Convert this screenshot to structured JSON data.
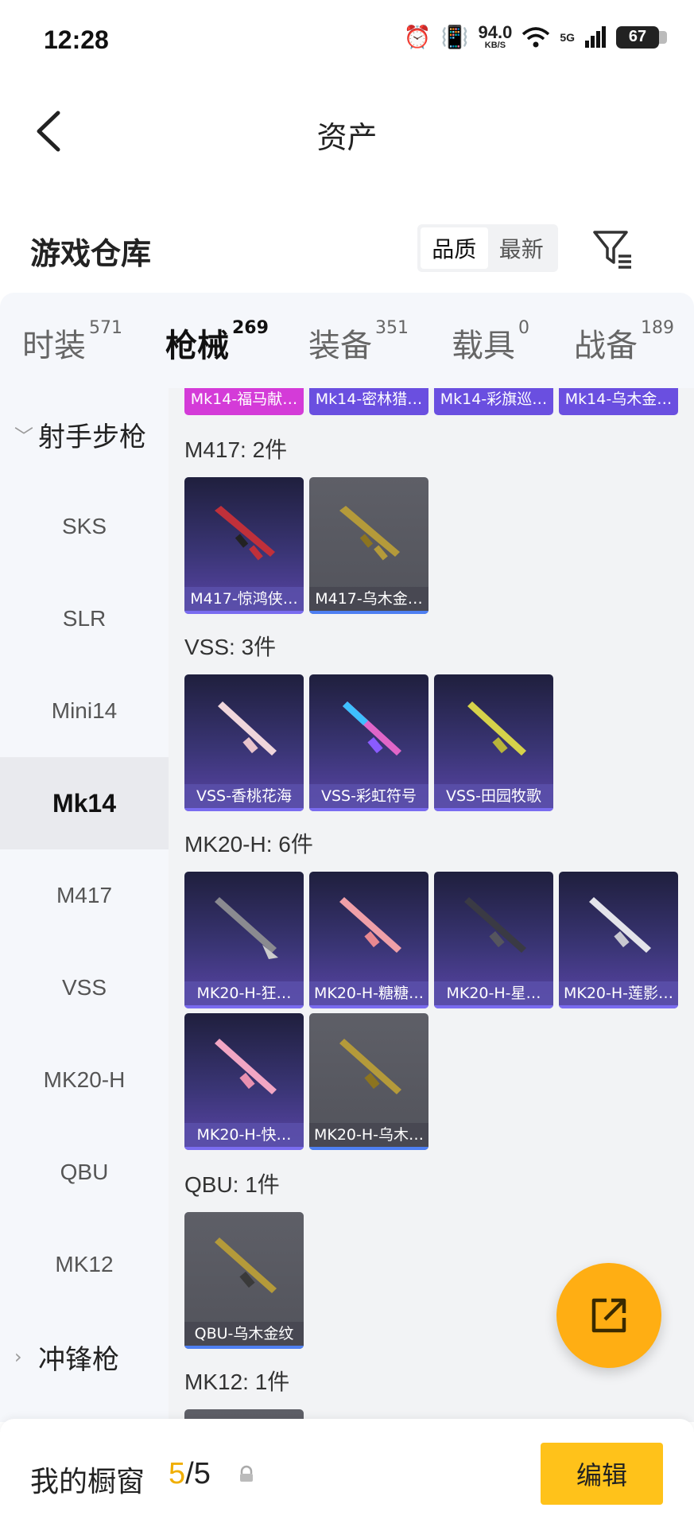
{
  "status_bar": {
    "time": "12:28",
    "speed_value": "94.0",
    "speed_unit": "KB/S",
    "network": "5G",
    "battery": "67"
  },
  "header": {
    "title": "资产",
    "back_icon": "chevron-left-icon"
  },
  "warehouse": {
    "title": "游戏仓库",
    "sort_options": [
      "品质",
      "最新"
    ],
    "active_sort": "品质",
    "filter_icon": "filter-icon"
  },
  "tabs": [
    {
      "label": "时装",
      "count": "571"
    },
    {
      "label": "枪械",
      "count": "269",
      "active": true
    },
    {
      "label": "装备",
      "count": "351"
    },
    {
      "label": "载具",
      "count": "0"
    },
    {
      "label": "战备",
      "count": "189"
    }
  ],
  "sidebar": {
    "group_open": "射手步枪",
    "items": [
      "SKS",
      "SLR",
      "Mini14",
      "Mk14",
      "M417",
      "VSS",
      "MK20-H",
      "QBU",
      "MK12"
    ],
    "active_item": "Mk14",
    "group_closed": "冲锋枪"
  },
  "content": {
    "top_row": [
      "Mk14-福马献…",
      "Mk14-密林猎…",
      "Mk14-彩旗巡…",
      "Mk14-乌木金…"
    ],
    "sections": [
      {
        "title": "M417: 2件",
        "items": [
          {
            "name": "M417-惊鸿侠…",
            "style": "purple"
          },
          {
            "name": "M417-乌木金…",
            "style": "gold"
          }
        ]
      },
      {
        "title": "VSS: 3件",
        "items": [
          {
            "name": "VSS-香桃花海",
            "style": "purple"
          },
          {
            "name": "VSS-彩虹符号",
            "style": "purple"
          },
          {
            "name": "VSS-田园牧歌",
            "style": "purple"
          }
        ]
      },
      {
        "title": "MK20-H: 6件",
        "items": [
          {
            "name": "MK20-H-狂…",
            "style": "purple"
          },
          {
            "name": "MK20-H-糖糖…",
            "style": "purple"
          },
          {
            "name": "MK20-H-星…",
            "style": "purple"
          },
          {
            "name": "MK20-H-莲影…",
            "style": "purple"
          },
          {
            "name": "MK20-H-快…",
            "style": "purple"
          },
          {
            "name": "MK20-H-乌木…",
            "style": "gold"
          }
        ]
      },
      {
        "title": "QBU: 1件",
        "items": [
          {
            "name": "QBU-乌木金纹",
            "style": "gold"
          }
        ]
      },
      {
        "title": "MK12: 1件",
        "items": []
      }
    ]
  },
  "fab": {
    "icon": "external-link-icon"
  },
  "bottom_bar": {
    "label": "我的橱窗",
    "current": "5",
    "total": "/5",
    "lock_icon": "lock-icon",
    "edit_label": "编辑"
  },
  "colors": {
    "accent": "#f5b400",
    "fab": "#ffae13",
    "edit_button": "#ffc21a",
    "card_purple": "#3a3575",
    "card_gold": "#55565e"
  }
}
